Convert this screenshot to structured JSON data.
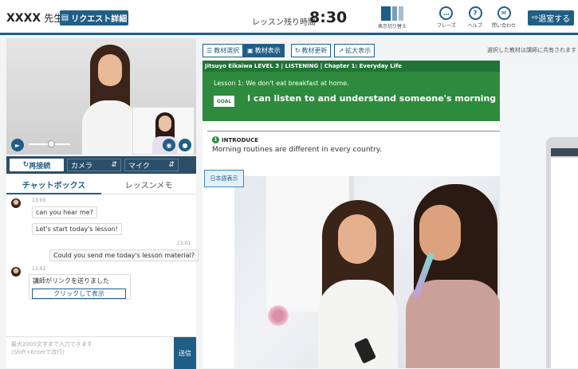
{
  "header": {
    "teacher_name": "XXXX",
    "teacher_honorific": "先生",
    "request_details_label": "リクエスト詳細",
    "remaining_time_label": "レッスン残り時間",
    "remaining_time_value": "8:30",
    "layout_switch_label": "表示切り替え",
    "phrase_label": "フレーズ",
    "help_label": "ヘルプ",
    "contact_label": "問い合わせ",
    "exit_label": "退室する"
  },
  "video": {
    "reconnect_label": "再接続",
    "camera_label": "カメラ",
    "mic_label": "マイク",
    "volume_level": 0.45
  },
  "tabs": {
    "chat_box": "チャットボックス",
    "lesson_memo": "レッスンメモ"
  },
  "chat": {
    "messages": [
      {
        "time": "13:00",
        "sender": "teacher",
        "text": "can you hear me?"
      },
      {
        "time": "",
        "sender": "teacher",
        "text": "Let's start today's lesson!"
      },
      {
        "time": "13:01",
        "sender": "student",
        "text": "Could you send me today's lesson material?"
      },
      {
        "time": "13:02",
        "sender": "teacher",
        "text": "講師がリンクを送りました"
      }
    ],
    "link_label": "クリックして表示"
  },
  "input": {
    "placeholder": "最大2000文字まで入力できます\n(Shift+Enterで改行)",
    "send_label": "送信"
  },
  "toolbar": {
    "select_material": "教材選択",
    "show_material": "教材表示",
    "update_material": "教材更新",
    "enlarge": "拡大表示",
    "share_note": "選択した教材は講師に共有されます"
  },
  "material": {
    "course_line": "Jitsuyo Eikaiwa LEVEL 3 | LISTENING | Chapter 1: Everyday Life",
    "lesson_title": "Lesson 1: We don't eat breakfast at home.",
    "goal_badge": "GOAL",
    "goal_text": "I can listen to and understand someone's morning routin",
    "intro_number": "1",
    "intro_heading": "INTRODUCE",
    "intro_text": "Morning routines are different in every country.",
    "japanese_button": "日本語表示"
  },
  "colors": {
    "brand": "#1f5f86",
    "lesson_green": "#2e8b3e",
    "course_green": "#217436"
  }
}
